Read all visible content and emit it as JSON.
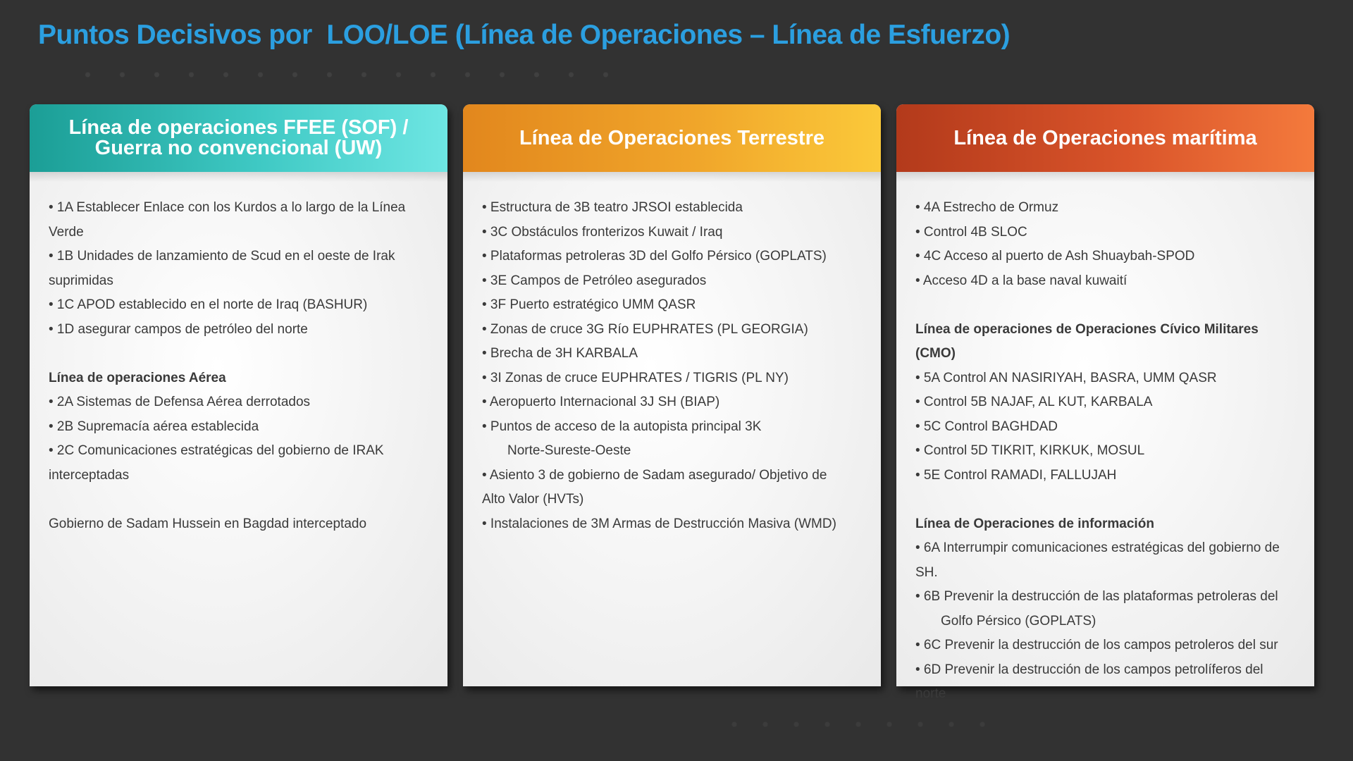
{
  "title": "Puntos Decisivos por  LOO/LOE (Línea de Operaciones – Línea de Esfuerzo)",
  "columns": [
    {
      "header": "Línea de operaciones FFEE (SOF) /\nGuerra no convencional (UW)",
      "lines": [
        {
          "text": "• 1A Establecer Enlace con los Kurdos a lo largo de la Línea",
          "style": "normal"
        },
        {
          "text": "Verde",
          "style": "normal"
        },
        {
          "text": "• 1B Unidades de lanzamiento de Scud en el oeste de Irak",
          "style": "normal"
        },
        {
          "text": "suprimidas",
          "style": "normal"
        },
        {
          "text": "• 1C APOD establecido en el norte de Iraq (BASHUR)",
          "style": "normal"
        },
        {
          "text": "• 1D asegurar campos de petróleo del norte",
          "style": "normal"
        },
        {
          "text": "",
          "style": "blank"
        },
        {
          "text": "Línea de operaciones Aérea",
          "style": "bold"
        },
        {
          "text": "•  2A Sistemas de Defensa Aérea derrotados",
          "style": "normal"
        },
        {
          "text": "• 2B Supremacía aérea establecida",
          "style": "normal"
        },
        {
          "text": "• 2C Comunicaciones estratégicas del gobierno de IRAK",
          "style": "normal"
        },
        {
          "text": "interceptadas",
          "style": "normal"
        },
        {
          "text": "",
          "style": "blank"
        },
        {
          "text": "Gobierno de Sadam Hussein en Bagdad interceptado",
          "style": "normal"
        }
      ]
    },
    {
      "header": "Línea de Operaciones Terrestre",
      "lines": [
        {
          "text": "• Estructura de 3B teatro JRSOI establecida",
          "style": "normal"
        },
        {
          "text": "• 3C Obstáculos fronterizos Kuwait / Iraq",
          "style": "normal"
        },
        {
          "text": "• Plataformas petroleras 3D del Golfo Pérsico (GOPLATS)",
          "style": "normal"
        },
        {
          "text": "• 3E Campos de Petróleo asegurados",
          "style": "normal"
        },
        {
          "text": "• 3F Puerto estratégico UMM QASR",
          "style": "normal"
        },
        {
          "text": "• Zonas de cruce 3G Río EUPHRATES (PL GEORGIA)",
          "style": "normal"
        },
        {
          "text": "• Brecha de 3H KARBALA",
          "style": "normal"
        },
        {
          "text": "• 3I Zonas de cruce EUPHRATES / TIGRIS (PL NY)",
          "style": "normal"
        },
        {
          "text": "• Aeropuerto Internacional 3J SH (BIAP)",
          "style": "normal"
        },
        {
          "text": "• Puntos de acceso de la autopista principal 3K",
          "style": "normal"
        },
        {
          "text": "Norte-Sureste-Oeste",
          "style": "indent"
        },
        {
          "text": "• Asiento 3 de gobierno de Sadam asegurado/ Objetivo de",
          "style": "normal"
        },
        {
          "text": "Alto Valor (HVTs)",
          "style": "normal"
        },
        {
          "text": "• Instalaciones de 3M Armas de Destrucción Masiva (WMD)",
          "style": "normal"
        }
      ]
    },
    {
      "header": "Línea de Operaciones marítima",
      "lines": [
        {
          "text": "• 4A Estrecho de Ormuz",
          "style": "normal"
        },
        {
          "text": "• Control 4B SLOC",
          "style": "normal"
        },
        {
          "text": "• 4C Acceso al puerto de Ash Shuaybah-SPOD",
          "style": "normal"
        },
        {
          "text": "• Acceso 4D a la base naval kuwaití",
          "style": "normal"
        },
        {
          "text": "",
          "style": "blank"
        },
        {
          "text": "Línea de operaciones de Operaciones Cívico Militares (CMO)",
          "style": "bold"
        },
        {
          "text": "• 5A Control AN NASIRIYAH, BASRA, UMM QASR",
          "style": "normal"
        },
        {
          "text": "• Control 5B NAJAF, AL KUT, KARBALA",
          "style": "normal"
        },
        {
          "text": "• 5C Control BAGHDAD",
          "style": "normal"
        },
        {
          "text": "• Control 5D TIKRIT, KIRKUK, MOSUL",
          "style": "normal"
        },
        {
          "text": "• 5E Control RAMADI, FALLUJAH",
          "style": "normal"
        },
        {
          "text": "",
          "style": "blank"
        },
        {
          "text": "Línea de Operaciones de  información",
          "style": "bold"
        },
        {
          "text": "• 6A Interrumpir comunicaciones estratégicas del gobierno de",
          "style": "normal"
        },
        {
          "text": "SH.",
          "style": "normal"
        },
        {
          "text": "• 6B Prevenir la destrucción de las plataformas petroleras del",
          "style": "normal"
        },
        {
          "text": "Golfo Pérsico (GOPLATS)",
          "style": "indent"
        },
        {
          "text": "• 6C Prevenir la destrucción de los campos petroleros del sur",
          "style": "normal"
        },
        {
          "text": "• 6D Prevenir la destrucción de los campos petrolíferos del",
          "style": "normal"
        },
        {
          "text": "norte",
          "style": "normal"
        }
      ]
    }
  ],
  "colors": {
    "background": "#323232",
    "title": "#2b9fe0",
    "teal_header": "#3fc9c4",
    "orange_header": "#f0a52a",
    "red_header": "#d9542a",
    "body_text": "#3a3a3a"
  }
}
